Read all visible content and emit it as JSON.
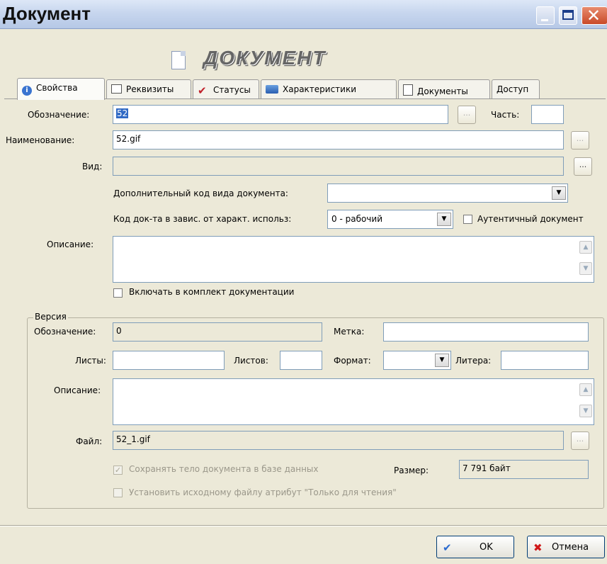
{
  "window": {
    "title": "Документ"
  },
  "header": {
    "title": "ДОКУМЕНТ"
  },
  "tabs": [
    {
      "label": "Свойства"
    },
    {
      "label": "Реквизиты"
    },
    {
      "label": "Статусы"
    },
    {
      "label": "Характеристики"
    },
    {
      "label": "Документы"
    },
    {
      "label": "Доступ"
    }
  ],
  "properties": {
    "designation_label": "Обозначение:",
    "designation_value": "52",
    "part_label": "Часть:",
    "part_value": "",
    "name_label": "Наименование:",
    "name_value": "52.gif",
    "kind_label": "Вид:",
    "kind_value": "",
    "extra_code_label": "Дополнительный код вида документа:",
    "extra_code_value": "",
    "usage_code_label": "Код док-та в завис. от характ. использ:",
    "usage_code_value": "0 - рабочий",
    "authentic_label": "Аутентичный документ",
    "description_label": "Описание:",
    "include_label": "Включать в комплект документации"
  },
  "version": {
    "legend": "Версия",
    "designation_label": "Обозначение:",
    "designation_value": "0",
    "mark_label": "Метка:",
    "sheets_label": "Листы:",
    "sheet_count_label": "Листов:",
    "format_label": "Формат:",
    "litera_label": "Литера:",
    "description_label": "Описание:",
    "file_label": "Файл:",
    "file_value": "52_1.gif",
    "save_body_label": "Сохранять тело документа в базе данных",
    "size_label": "Размер:",
    "size_value": "7 791 байт",
    "readonly_attr_label": "Установить исходному файлу атрибут \"Только для чтения\""
  },
  "buttons": {
    "ok": "OK",
    "cancel": "Отмена",
    "ellipsis": "..."
  },
  "icons": [
    "info-icon",
    "requisites-icon",
    "checkmark-icon",
    "characteristics-icon",
    "documents-icon",
    "ok-check-icon",
    "cancel-x-icon"
  ],
  "colors": {
    "accent": "#7f9db9",
    "close": "#c94a28",
    "cancel_x": "#d01818",
    "check": "#2a6ad0"
  }
}
